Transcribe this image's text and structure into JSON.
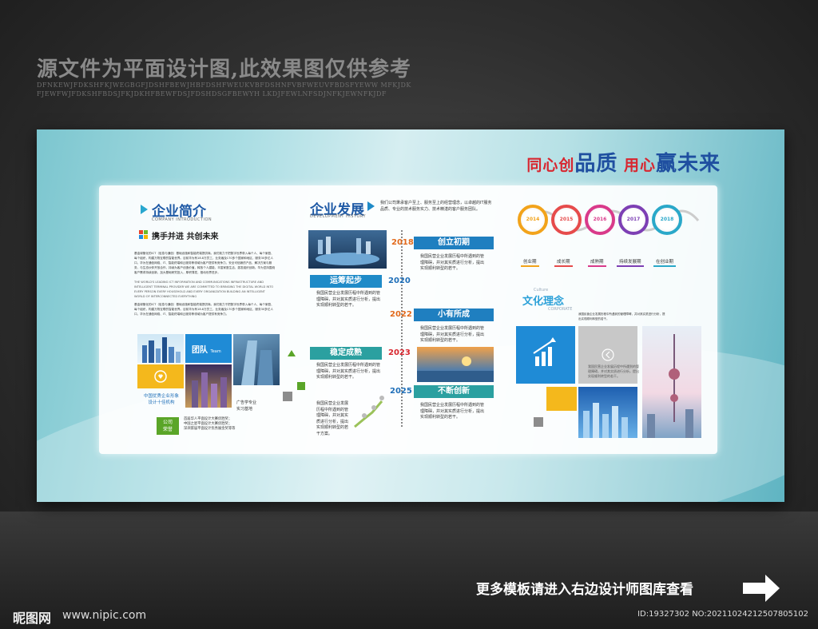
{
  "watermark": {
    "title": "源文件为平面设计图,此效果图仅供参考",
    "letters": "DFNKEWJFDKSHFKJWEGBGFJDSHFBEWJHBFDSHFWEUKVBFDSHNFVBFWEUVFBDSFYEWW MFKJDKFJEWFWJFDKSHFBDSJFKJDKHFBEWFDSJFDSHDSGFBEWYH LKDJFEWLNFSDJNFKJEWNFKJDF"
  },
  "slogan": {
    "p1": "同心创",
    "p2": "品质",
    "p3": " 用心",
    "p4": "赢未来"
  },
  "intro": {
    "title": "企业简介",
    "subtitle": "COMPANY INTRODUCTION",
    "motto": "携手并进 共创未来",
    "para1": "基金绿管化的ICT（信息与通信）基础设施和智能终端提供商。我们致力于把数字世界带入每个人、每个家庭、每个组织，构建万物互联的智能世界。目前华为有18.8万员工，业务遍及170多个国家和地区，服务30多亿人口。华为在通信网络、IT、智能终端和云服务等领域为客户提供有竞争力、安全可信赖的产品、解决方案与服务，与生态伙伴开放合作，持续为客户创造价值，释放个人潜能，丰富家庭生活，激发组织创新。华为坚持围绕客户需求持续创新，加大基础研究投入，厚积薄发，推动世界进步。",
    "para2": "THE WORLD'S LEADING ICT INFORMATION AND COMMUNICATIONS INFRASTRUCTURE AND INTELLIGENT TERMINAL PROVIDER WE ARE COMMITTED TO BRINGING THE DIGITAL WORLD INTO EVERY PERSON EVERY HOUSEHOLD AND EVERY ORGANIZATION BUILDING AN INTELLIGENT WORLD OF INTERCONNECTED EVERYTHING",
    "para3": "基金绿管化的ICT（信息与通信）基础设施和智能终端提供商。我们致力于把数字世界带入每个人、每个家庭、每个组织，构建万物互联的智能世界。目前华为有18.8万员工，业务遍及170多个国家和地区，服务30多亿人口。华为在通信网络、IT、智能终端和云服务等领域为客户提供有竞争力。",
    "team_label": "团队",
    "team_en": "Team",
    "honor_text": "中国优秀企业形象\n设计十佳机构",
    "base_text": "广告学专业\n实习基地",
    "badge": "公司\n荣誉",
    "badge_text": "首届华人平面设计大赛优胜奖；\n中国之星平面设计大赛优胜奖；\n深圳第届平面设计优秀展金奖等等"
  },
  "history": {
    "title": "企业发展",
    "subtitle": "DEVELOPMENT HISTORY",
    "intro": "我们公司秉承客户至上、服务至上的经营理念，以卓越的IT服务品质、专业的技术服务实力、技术精湛的客户服务团队。",
    "filler": "我国民营企业发展历程中所遇到的管理障碍，并对其实质进行分析，提出实现顺利转型的若干。",
    "milestones": [
      {
        "year": "2018",
        "stage": "创立初期",
        "color": "#e26a1c"
      },
      {
        "year": "2020",
        "stage": "运筹起步",
        "color": "#1f6fb8"
      },
      {
        "year": "2022",
        "stage": "小有所成",
        "color": "#e26a1c"
      },
      {
        "year": "2023",
        "stage": "稳定成熟",
        "color": "#d8262f"
      },
      {
        "year": "2025",
        "stage": "不断创新",
        "color": "#1f6fb8"
      }
    ],
    "filler_short": "我国民营企业发展历程中所遇到的管理障碍，并对其实质进行分析，提出实现顺利转型的若干方案。"
  },
  "process": {
    "rings": [
      {
        "year": "2014",
        "label": "创业期",
        "color": "#f2a31b"
      },
      {
        "year": "2015",
        "label": "成长期",
        "color": "#e64b4b"
      },
      {
        "year": "2016",
        "label": "成熟期",
        "color": "#d93a8a"
      },
      {
        "year": "2017",
        "label": "持续发展期",
        "color": "#7d3fb4"
      },
      {
        "year": "2018",
        "label": "在创业期",
        "color": "#2aa8c9"
      }
    ]
  },
  "culture": {
    "title": "文化理念",
    "culture_tag": "Culture",
    "en": "CORPORATE",
    "desc": "我国民营企业发展历程中所遇到的管理障碍，并对其实质进行分析，提出实现顺利转型的若干。"
  },
  "footer": {
    "cta": "更多模板请进入右边设计师图库查看",
    "site_logo": "昵图网",
    "site_url": "www.nipic.com",
    "image_id": "ID:19327302 NO:20211024212507805102"
  }
}
